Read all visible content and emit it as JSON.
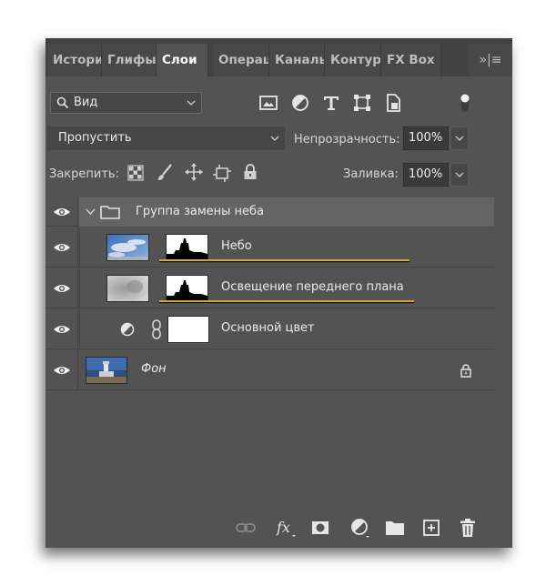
{
  "tabs": [
    {
      "label": "Истори",
      "active": false
    },
    {
      "label": "Глифы",
      "active": false
    },
    {
      "label": "Слои",
      "active": true
    },
    {
      "label": "Операц",
      "active": false
    },
    {
      "label": "Каналь",
      "active": false
    },
    {
      "label": "Контур",
      "active": false
    },
    {
      "label": "FX Box",
      "active": false
    }
  ],
  "tab_menu_glyph": "»|≡",
  "filter": {
    "label": "Вид",
    "icon": "search-icon"
  },
  "filter_tools": [
    "image-icon",
    "adjustment-icon",
    "type-icon",
    "transform-icon",
    "smart-object-icon",
    "filter-toggle-icon"
  ],
  "blend_mode": "Пропустить",
  "opacity": {
    "label": "Непрозрачность:",
    "value": "100%"
  },
  "lock": {
    "label": "Закрепить:",
    "icons": [
      "lock-transparent-icon",
      "lock-paint-icon",
      "lock-move-icon",
      "lock-artboard-icon",
      "lock-all-icon"
    ]
  },
  "fill": {
    "label": "Заливка:",
    "value": "100%"
  },
  "layers": {
    "group": {
      "name": "Группа замены неба"
    },
    "sky": {
      "name": "Небо"
    },
    "foreground": {
      "name": "Освещение переднего плана"
    },
    "base_color": {
      "name": "Основной цвет"
    },
    "background": {
      "name": "Фон"
    }
  },
  "colors": {
    "highlight_underline": "#d8a82a",
    "panel_bg": "#535353",
    "tab_bg": "#424242"
  },
  "bottom_tools": [
    "link-icon",
    "fx-icon",
    "mask-icon",
    "adjustment-layer-icon",
    "new-group-icon",
    "new-layer-icon",
    "trash-icon"
  ]
}
